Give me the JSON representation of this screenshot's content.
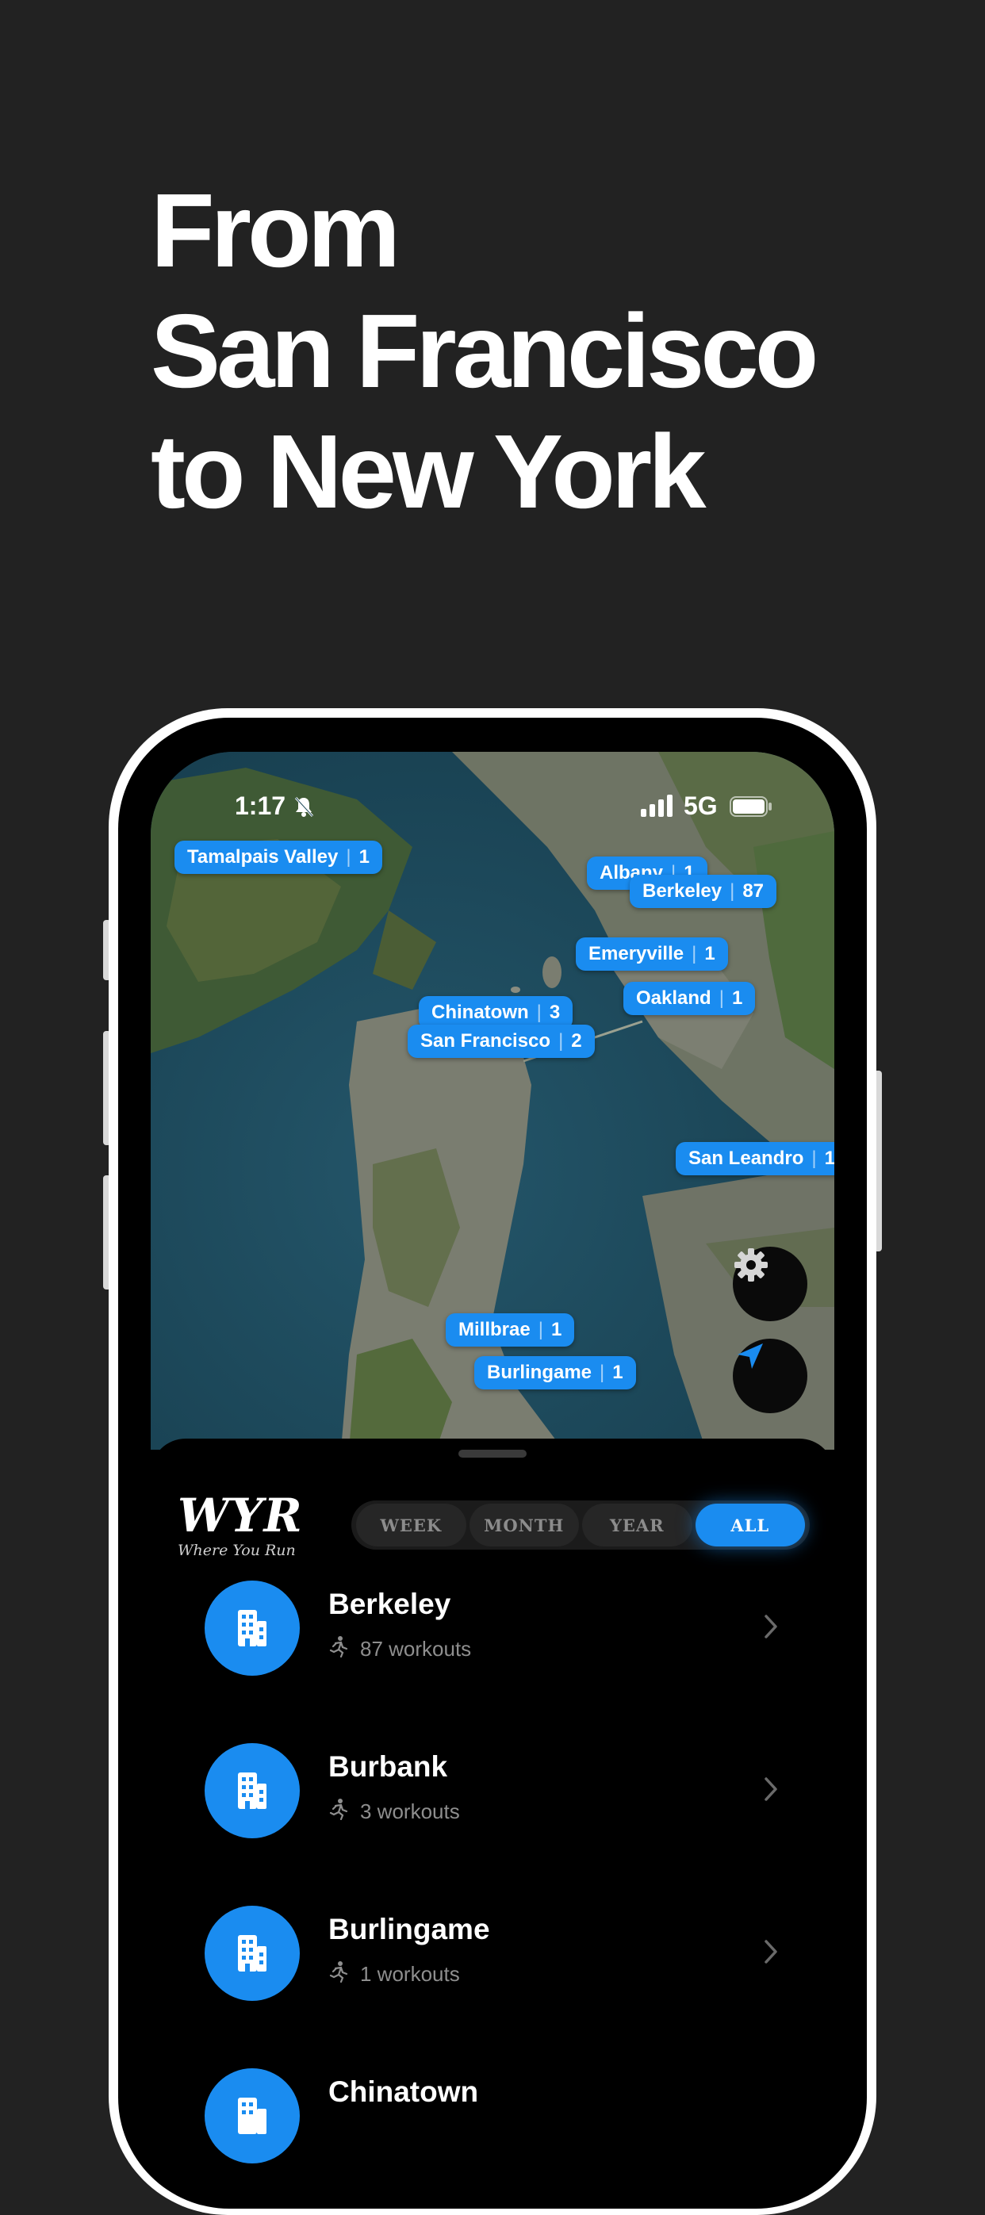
{
  "headline": {
    "line1": "From",
    "line2": "San Francisco",
    "line3": "to New York"
  },
  "status_bar": {
    "time": "1:17",
    "network": "5G"
  },
  "map": {
    "pins": [
      {
        "name": "Tamalpais Valley",
        "count": "1"
      },
      {
        "name": "Albany",
        "count": "1"
      },
      {
        "name": "Berkeley",
        "count": "87"
      },
      {
        "name": "Emeryville",
        "count": "1"
      },
      {
        "name": "Oakland",
        "count": "1"
      },
      {
        "name": "Chinatown",
        "count": "3"
      },
      {
        "name": "San Francisco",
        "count": "2"
      },
      {
        "name": "San Leandro",
        "count": "1"
      },
      {
        "name": "Millbrae",
        "count": "1"
      },
      {
        "name": "Burlingame",
        "count": "1"
      }
    ],
    "controls": {
      "settings_icon": "gear-icon",
      "location_icon": "location-arrow-icon"
    }
  },
  "sheet": {
    "logo": {
      "mark": "WYR",
      "tagline": "Where You Run"
    },
    "segments": [
      {
        "label": "WEEK",
        "active": false
      },
      {
        "label": "MONTH",
        "active": false
      },
      {
        "label": "YEAR",
        "active": false
      },
      {
        "label": "ALL",
        "active": true
      }
    ],
    "places": [
      {
        "name": "Berkeley",
        "workouts": "87 workouts"
      },
      {
        "name": "Burbank",
        "workouts": "3 workouts"
      },
      {
        "name": "Burlingame",
        "workouts": "1 workouts"
      },
      {
        "name": "Chinatown",
        "workouts": ""
      }
    ]
  },
  "colors": {
    "background": "#222222",
    "accent": "#1a8cf0",
    "sheet": "#000000"
  }
}
